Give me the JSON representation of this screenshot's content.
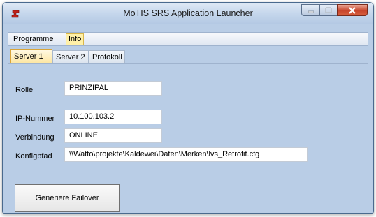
{
  "window": {
    "title": "MoTIS SRS Application Launcher"
  },
  "menu": {
    "items": [
      {
        "label": "Programme"
      },
      {
        "label": "Info",
        "active": true
      }
    ]
  },
  "tabs": [
    {
      "label": "Server 1",
      "active": true
    },
    {
      "label": "Server 2"
    },
    {
      "label": "Protokoll"
    }
  ],
  "fields": {
    "rolle": {
      "label": "Rolle",
      "value": "PRINZIPAL"
    },
    "ip": {
      "label": "IP-Nummer",
      "value": "10.100.103.2"
    },
    "verbindung": {
      "label": "Verbindung",
      "value": "ONLINE"
    },
    "konfigpfad": {
      "label": "Konfigpfad",
      "value": "\\\\Watto\\projekte\\Kaldewei\\Daten\\Merken\\lvs_Retrofit.cfg"
    }
  },
  "actions": {
    "failover_label": "Generiere Failover"
  },
  "icons": {
    "app": "red-app-icon",
    "minimize": "minimize-icon",
    "maximize": "maximize-icon",
    "close": "close-icon"
  },
  "colors": {
    "accent_tab": "#fde6a0",
    "background": "#b9cde6",
    "close_button": "#c8452b"
  }
}
